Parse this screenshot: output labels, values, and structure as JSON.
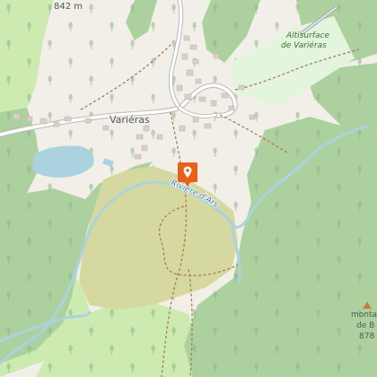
{
  "map": {
    "village_label": "Variéras",
    "river_label": "Rivière d'Ars",
    "airfield_label_line1": "Altisurface",
    "airfield_label_line2": "de Variéras",
    "elevation_label": "842 m",
    "peak_label_line1": "monta",
    "peak_label_line2": "de B",
    "peak_label_line3": "878",
    "marker_icon": "map-pin-icon",
    "colors": {
      "land": "#f2efe9",
      "forest": "#add19e",
      "grass": "#cdebb0",
      "meadow": "#d6d99f",
      "water": "#aad3df",
      "river_text": "#3d6fa0",
      "airfield": "#e4f5dd",
      "marker": "#e8611a",
      "peak": "#d0744a"
    }
  }
}
